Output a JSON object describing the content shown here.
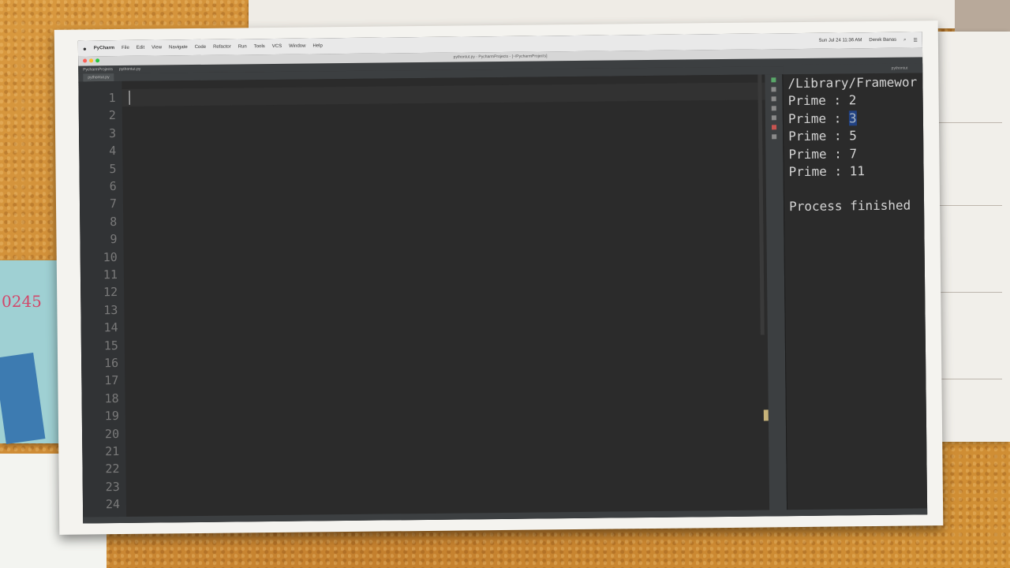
{
  "menubar": {
    "app": "PyCharm",
    "items": [
      "File",
      "Edit",
      "View",
      "Navigate",
      "Code",
      "Refactor",
      "Run",
      "Tools",
      "VCS",
      "Window",
      "Help"
    ],
    "datetime": "Sun Jul 24  11:36 AM",
    "user": "Derek Banas"
  },
  "window": {
    "title": "pythontut.py - PycharmProjects - [~/PycharmProjects]"
  },
  "breadcrumbs": [
    "PycharmProjects",
    "pythontut.py"
  ],
  "tabs": [
    "pythontut.py"
  ],
  "editor": {
    "line_numbers": [
      "1",
      "2",
      "3",
      "4",
      "5",
      "6",
      "7",
      "8",
      "9",
      "10",
      "11",
      "12",
      "13",
      "14",
      "15",
      "16",
      "17",
      "18",
      "19",
      "20",
      "21",
      "22",
      "23",
      "24"
    ]
  },
  "run_panel": {
    "header": "pythontut",
    "path": "/Library/Framewor",
    "output": [
      {
        "label": "Prime : ",
        "value": "2"
      },
      {
        "label": "Prime : ",
        "value": "3"
      },
      {
        "label": "Prime : ",
        "value": "5"
      },
      {
        "label": "Prime : ",
        "value": "7"
      },
      {
        "label": "Prime : ",
        "value": "11"
      }
    ],
    "finished": "Process finished"
  },
  "background": {
    "stamp_number": "0245"
  },
  "colors": {
    "editor_bg": "#2b2b2b",
    "gutter_bg": "#313335",
    "selection": "#214283",
    "cork": "#c98a3a"
  }
}
